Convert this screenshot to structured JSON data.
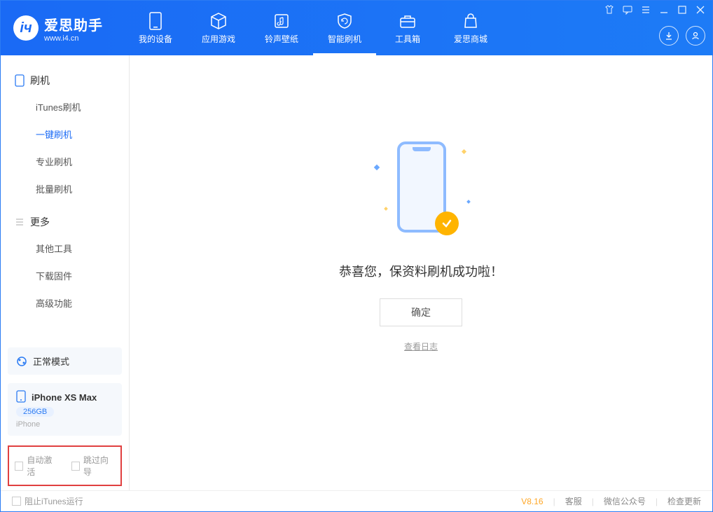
{
  "app": {
    "title": "爱思助手",
    "url": "www.i4.cn"
  },
  "tabs": [
    {
      "label": "我的设备"
    },
    {
      "label": "应用游戏"
    },
    {
      "label": "铃声壁纸"
    },
    {
      "label": "智能刷机"
    },
    {
      "label": "工具箱"
    },
    {
      "label": "爱思商城"
    }
  ],
  "sidebar": {
    "section1": {
      "title": "刷机",
      "items": [
        "iTunes刷机",
        "一键刷机",
        "专业刷机",
        "批量刷机"
      ]
    },
    "section2": {
      "title": "更多",
      "items": [
        "其他工具",
        "下载固件",
        "高级功能"
      ]
    }
  },
  "device": {
    "mode": "正常模式",
    "name": "iPhone XS Max",
    "storage": "256GB",
    "type": "iPhone"
  },
  "options": {
    "autoActivate": "自动激活",
    "skipGuide": "跳过向导"
  },
  "result": {
    "message": "恭喜您，保资料刷机成功啦！",
    "confirm": "确定",
    "viewLog": "查看日志"
  },
  "footer": {
    "blockItunes": "阻止iTunes运行",
    "version": "V8.16",
    "support": "客服",
    "wechat": "微信公众号",
    "update": "检查更新"
  }
}
